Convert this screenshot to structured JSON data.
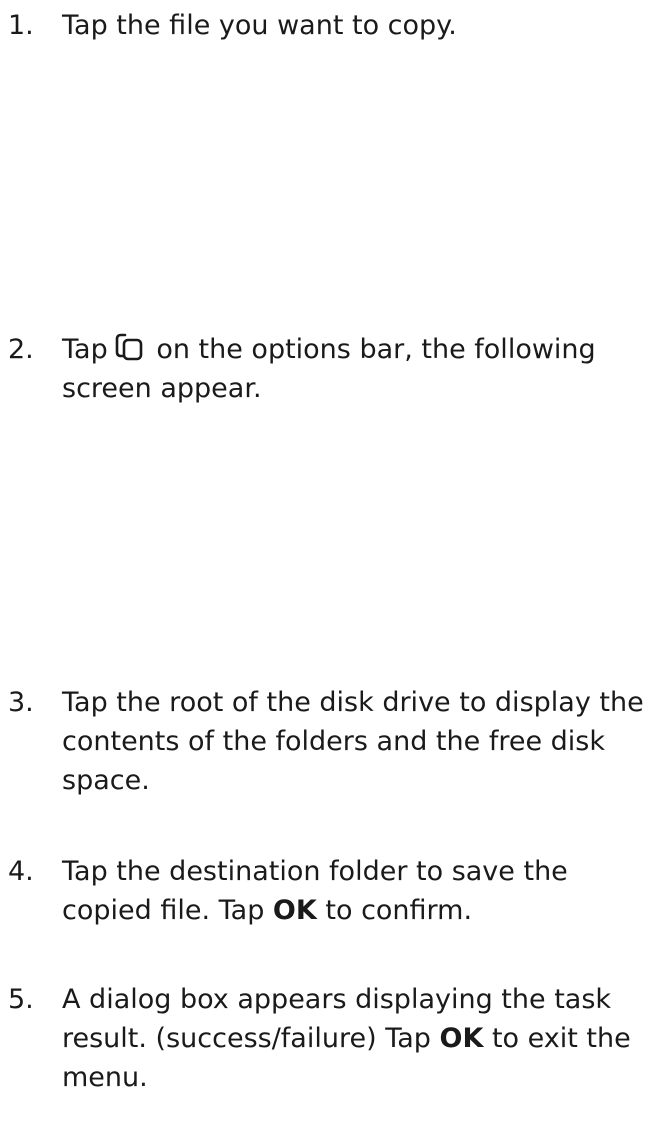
{
  "steps": [
    {
      "number": "1.",
      "text": "Tap the file you want to copy."
    },
    {
      "number": "2.",
      "before_icon": "Tap",
      "icon": "copy-icon",
      "after_icon": "on the options bar, the following screen appear."
    },
    {
      "number": "3.",
      "text": "Tap the root of the disk drive to display the contents of the folders and the free disk space."
    },
    {
      "number": "4.",
      "text_a": "Tap the destination folder to save the copied file. Tap ",
      "bold": "OK",
      "text_b": " to confirm."
    },
    {
      "number": "5.",
      "text_a": "A dialog box appears displaying the task result. (success/failure) Tap ",
      "bold": "OK",
      "text_b": " to exit the menu."
    }
  ]
}
